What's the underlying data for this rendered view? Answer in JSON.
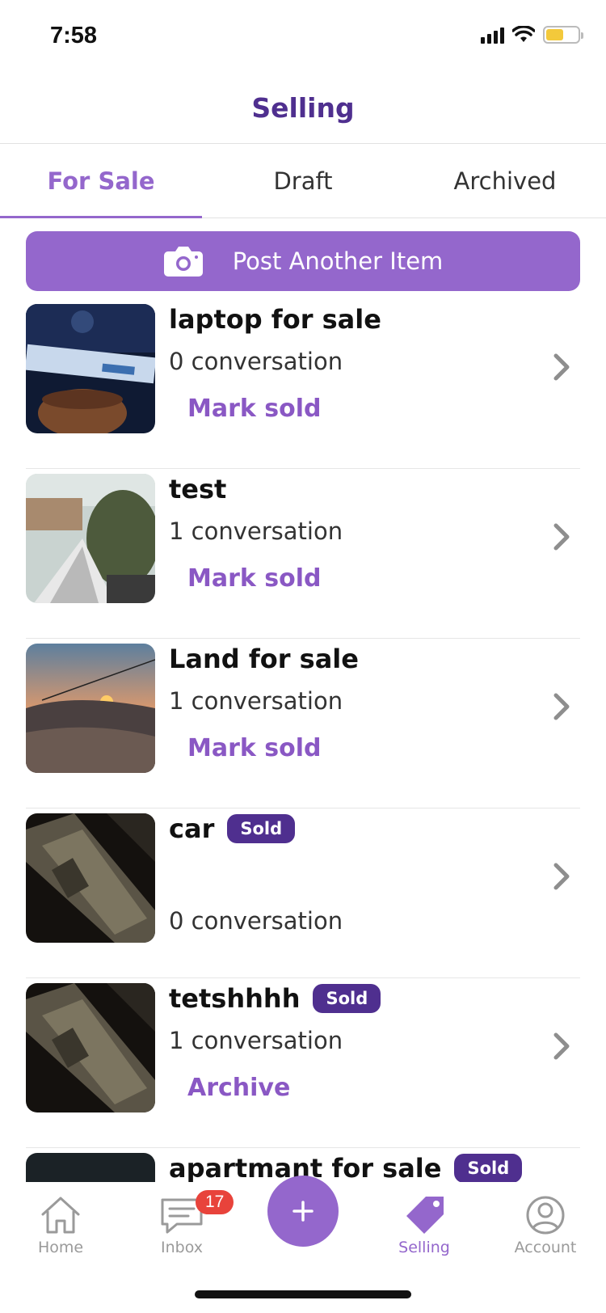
{
  "status_bar": {
    "time": "7:58"
  },
  "header": {
    "title": "Selling"
  },
  "tabs": [
    {
      "label": "For Sale",
      "active": true
    },
    {
      "label": "Draft",
      "active": false
    },
    {
      "label": "Archived",
      "active": false
    }
  ],
  "post_button": {
    "label": "Post Another Item",
    "icon": "camera-icon"
  },
  "listings": [
    {
      "title": "laptop for sale",
      "conversations": "0 conversation",
      "action": "Mark sold",
      "badge": ""
    },
    {
      "title": "test",
      "conversations": "1 conversation",
      "action": "Mark sold",
      "badge": ""
    },
    {
      "title": "Land for sale",
      "conversations": "1 conversation",
      "action": "Mark sold",
      "badge": ""
    },
    {
      "title": "car",
      "conversations": "0 conversation",
      "action": "",
      "badge": "Sold"
    },
    {
      "title": "tetshhhh",
      "conversations": "1 conversation",
      "action": "Archive",
      "badge": "Sold"
    },
    {
      "title": "apartmant for sale",
      "conversations": "",
      "action": "",
      "badge": "Sold"
    }
  ],
  "tab_bar": {
    "home": "Home",
    "inbox": "Inbox",
    "inbox_badge": "17",
    "selling": "Selling",
    "account": "Account"
  },
  "colors": {
    "accent": "#9467cc",
    "dark_purple": "#4f2f8f",
    "badge_red": "#e8433b"
  }
}
